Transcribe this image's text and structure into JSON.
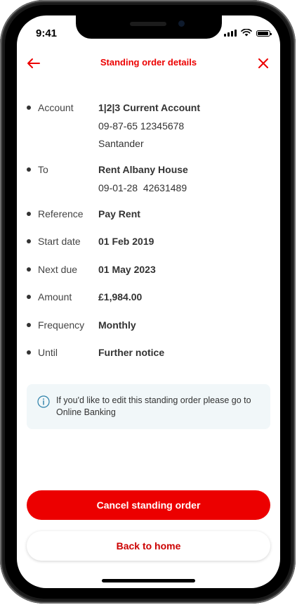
{
  "status_bar": {
    "time": "9:41"
  },
  "header": {
    "title": "Standing order details"
  },
  "details": [
    {
      "label": "Account",
      "lines": [
        "1|2|3 Current Account",
        "09-87-65 12345678",
        "Santander"
      ]
    },
    {
      "label": "To",
      "lines": [
        "Rent Albany House",
        "09-01-28  42631489"
      ]
    },
    {
      "label": "Reference",
      "lines": [
        "Pay Rent"
      ]
    },
    {
      "label": "Start date",
      "lines": [
        "01 Feb 2019"
      ]
    },
    {
      "label": "Next due",
      "lines": [
        "01 May 2023"
      ]
    },
    {
      "label": "Amount",
      "lines": [
        "£1,984.00"
      ]
    },
    {
      "label": "Frequency",
      "lines": [
        "Monthly"
      ]
    },
    {
      "label": "Until",
      "lines": [
        "Further notice"
      ]
    }
  ],
  "info": {
    "text": "If you'd like to edit this standing order please go to Online Banking",
    "icon": "info-icon"
  },
  "actions": {
    "cancel_label": "Cancel standing order",
    "home_label": "Back to home"
  },
  "colors": {
    "brand": "#ec0000",
    "info_bg": "#f1f7f9"
  }
}
